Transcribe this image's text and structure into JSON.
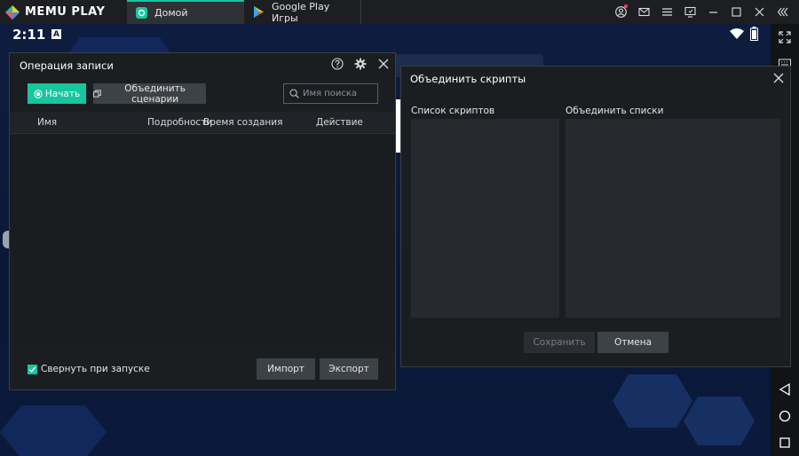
{
  "app": {
    "logo_text": "MEMU PLAY",
    "tabs": [
      {
        "label": "Домой",
        "icon": "memu-home-icon",
        "active": true
      },
      {
        "label": "Google Play Игры",
        "icon": "google-play-icon",
        "active": false
      }
    ],
    "accent_color": "#17c59e"
  },
  "status_bar": {
    "time": "2:11",
    "notification": "A"
  },
  "record_dialog": {
    "title": "Операция записи",
    "start_label": "Начать",
    "merge_label": "Объединить сценарии",
    "search_placeholder": "Имя поиска",
    "columns": {
      "name": "Имя",
      "details": "Подробности",
      "created": "Время создания",
      "action": "Действие"
    },
    "collapse_label": "Свернуть при запуске",
    "collapse_checked": true,
    "import_label": "Импорт",
    "export_label": "Экспорт"
  },
  "merge_dialog": {
    "title": "Объединить скрипты",
    "scripts_list_label": "Список скриптов",
    "merge_lists_label": "Объединить списки",
    "save_label": "Сохранить",
    "cancel_label": "Отмена"
  }
}
